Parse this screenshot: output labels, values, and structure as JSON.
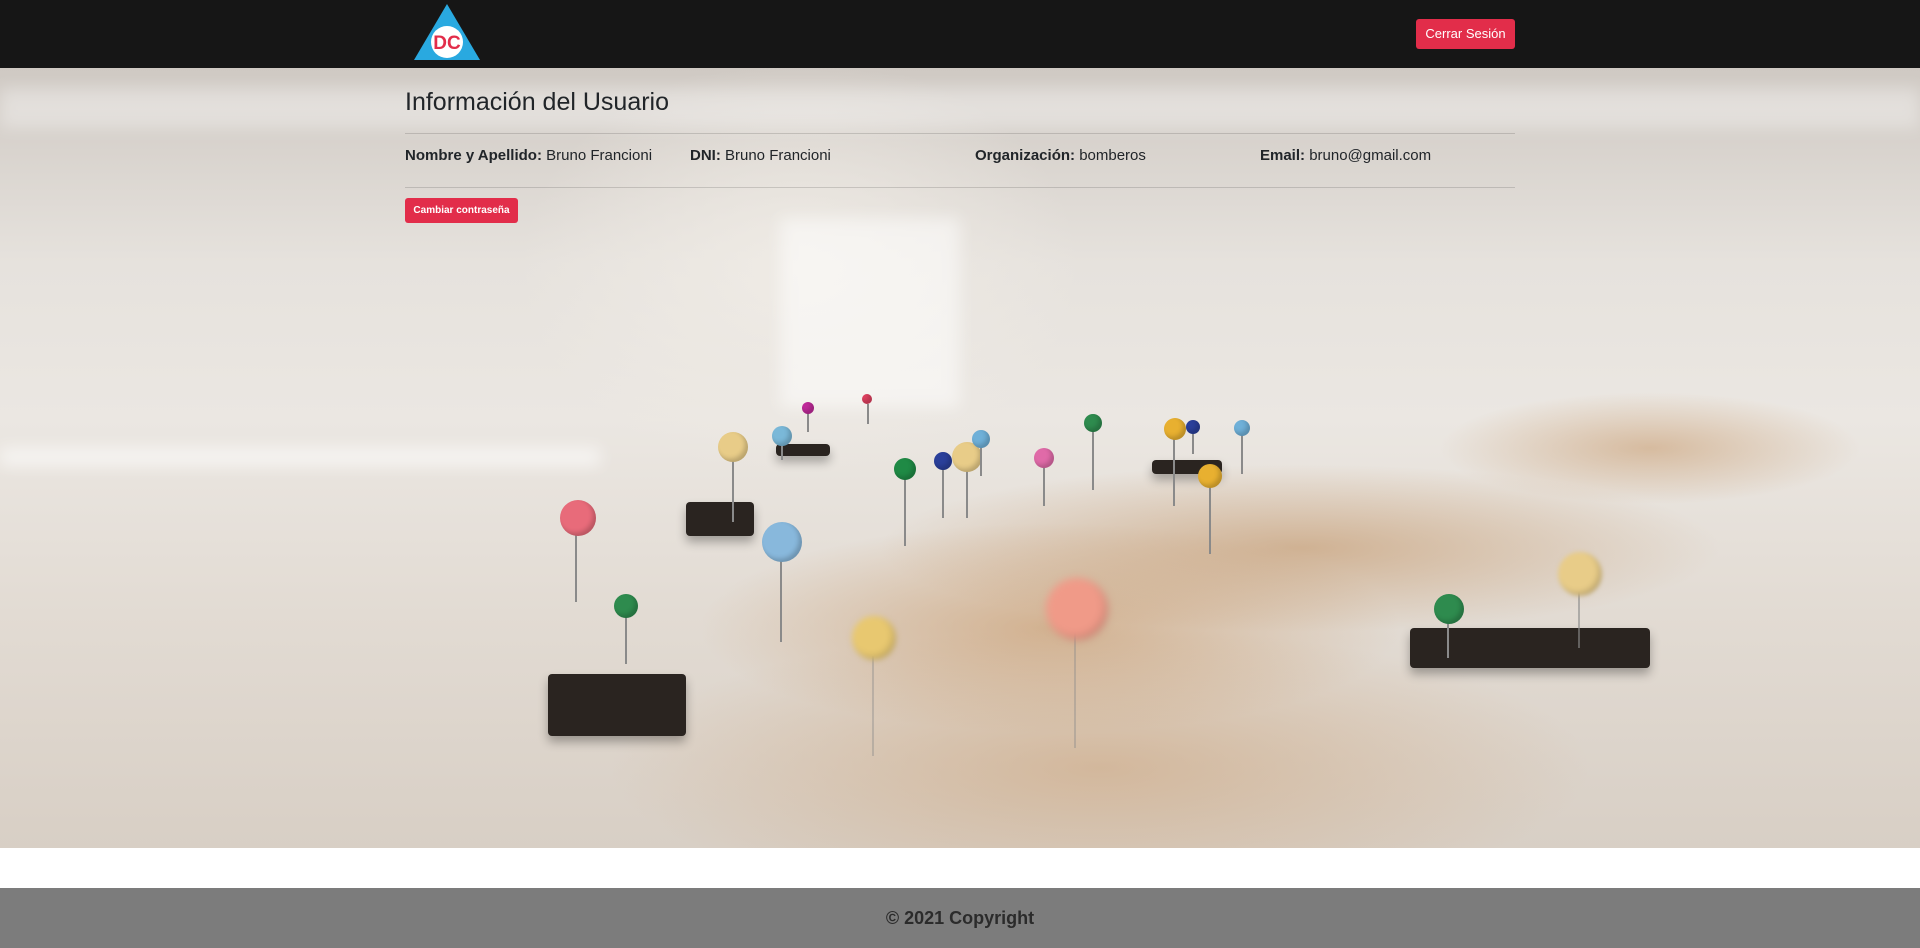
{
  "header": {
    "logo_text": "DC",
    "logout_label": "Cerrar Sesión"
  },
  "main": {
    "title": "Información del Usuario",
    "fields": [
      {
        "label": "Nombre y Apellido:",
        "value": "Bruno Francioni"
      },
      {
        "label": "DNI:",
        "value": "Bruno Francioni"
      },
      {
        "label": "Organización:",
        "value": "bomberos"
      },
      {
        "label": "Email:",
        "value": "bruno@gmail.com"
      }
    ],
    "change_password_label": "Cambiar contraseña"
  },
  "footer": {
    "copyright": "© 2021 Copyright"
  },
  "colors": {
    "navbar": "#161616",
    "accent": "#e22d4a",
    "footer": "#7c7c7c",
    "logo_triangle": "#29a9e0",
    "logo_circle_text": "#e22d4a"
  }
}
